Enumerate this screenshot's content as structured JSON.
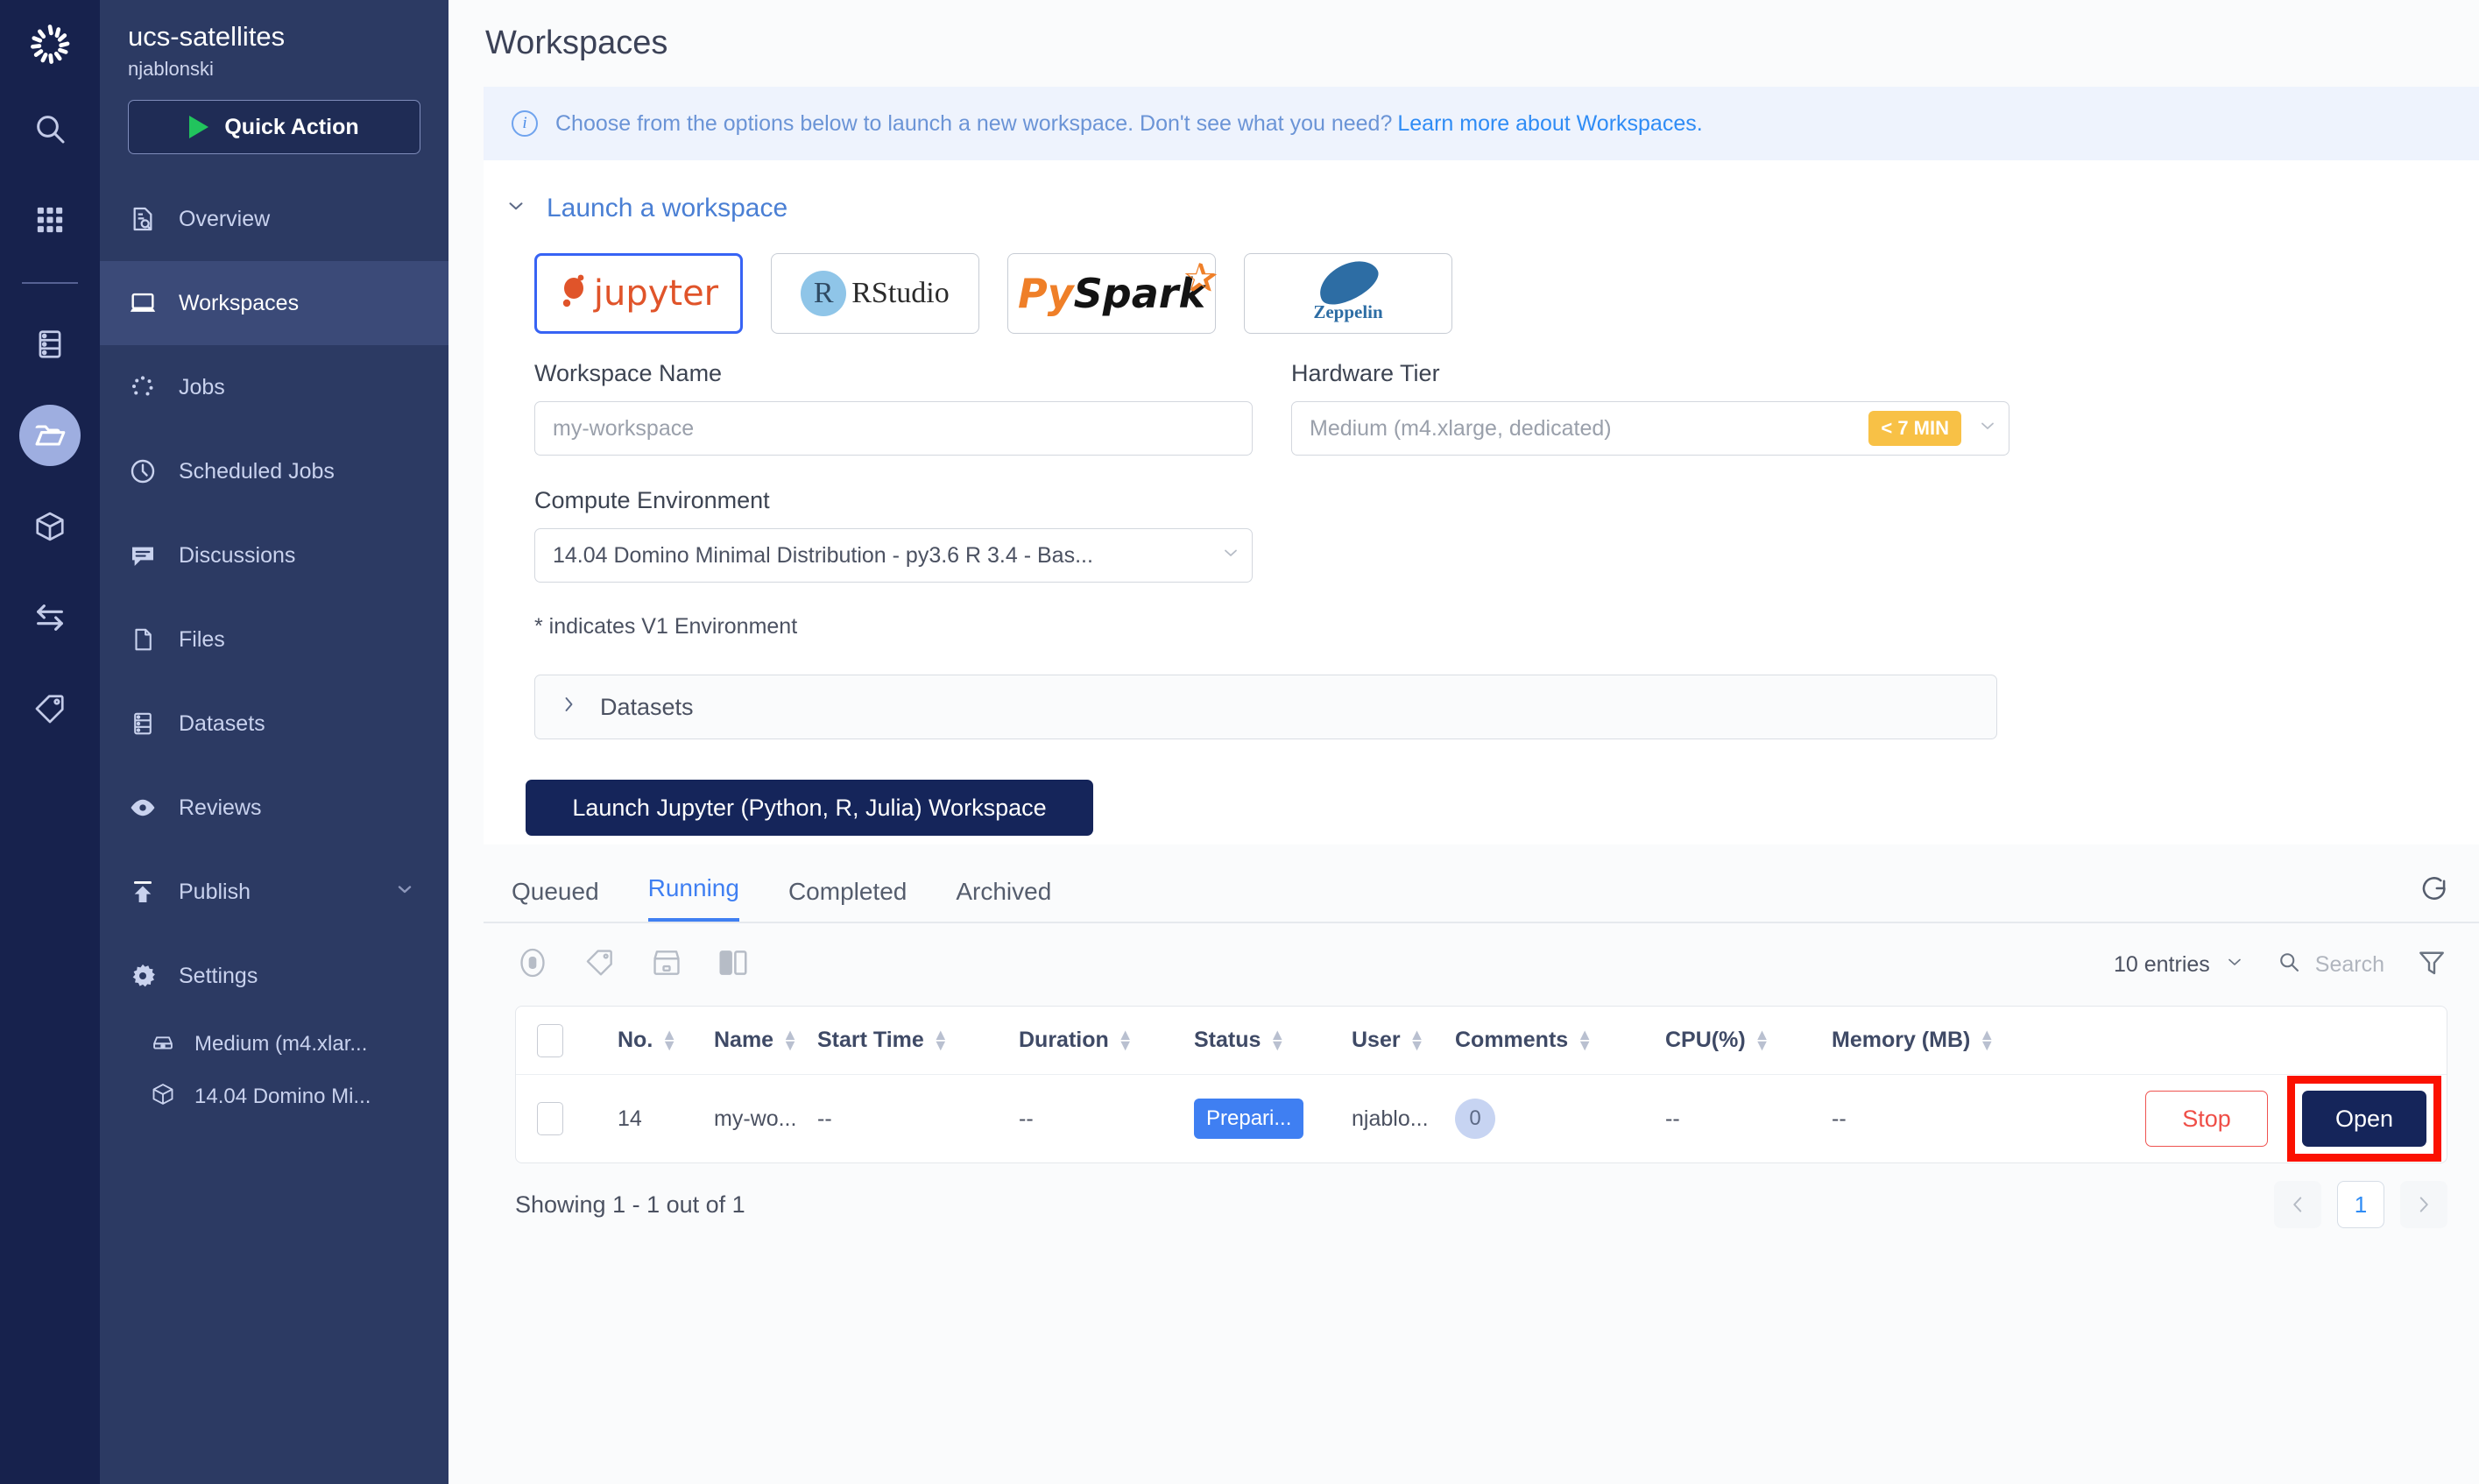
{
  "rail": {
    "logo_icon": "domino-logo-icon",
    "items": [
      {
        "icon": "search-icon",
        "active": false
      },
      {
        "icon": "grid-apps-icon",
        "active": false
      },
      {
        "icon": "server-icon",
        "active": false
      },
      {
        "icon": "folder-open-icon",
        "active": true
      },
      {
        "icon": "cube-icon",
        "active": false
      },
      {
        "icon": "transfer-arrows-icon",
        "active": false
      },
      {
        "icon": "tag-icon",
        "active": false
      }
    ]
  },
  "sidebar": {
    "project_name": "ucs-satellites",
    "owner": "njablonski",
    "quick_action_label": "Quick Action",
    "items": [
      {
        "label": "Overview",
        "icon": "document-search-icon",
        "active": false
      },
      {
        "label": "Workspaces",
        "icon": "laptop-icon",
        "active": true
      },
      {
        "label": "Jobs",
        "icon": "spinner-dots-icon",
        "active": false
      },
      {
        "label": "Scheduled Jobs",
        "icon": "clock-icon",
        "active": false
      },
      {
        "label": "Discussions",
        "icon": "chat-bubble-icon",
        "active": false
      },
      {
        "label": "Files",
        "icon": "file-icon",
        "active": false
      },
      {
        "label": "Datasets",
        "icon": "database-icon",
        "active": false
      },
      {
        "label": "Reviews",
        "icon": "eye-icon",
        "active": false
      },
      {
        "label": "Publish",
        "icon": "upload-icon",
        "active": false,
        "expandable": true
      },
      {
        "label": "Settings",
        "icon": "gear-icon",
        "active": false
      }
    ],
    "sub_items": [
      {
        "label": "Medium (m4.xlar...",
        "icon": "hardware-tier-icon"
      },
      {
        "label": "14.04 Domino Mi...",
        "icon": "cube-icon"
      }
    ]
  },
  "main": {
    "page_title": "Workspaces",
    "info_banner": {
      "icon": "info-icon",
      "text": "Choose from the options below to launch a new workspace. Don't see what you need?",
      "link_text": "Learn more about Workspaces."
    },
    "launch_section": {
      "toggle_icon": "chevron-down-icon",
      "title": "Launch a workspace",
      "ide_cards": [
        {
          "name": "jupyter",
          "label": "jupyter",
          "selected": true
        },
        {
          "name": "rstudio",
          "label": "RStudio",
          "selected": false
        },
        {
          "name": "pyspark",
          "label": "PySpark",
          "selected": false
        },
        {
          "name": "zeppelin",
          "label": "Zeppelin",
          "selected": false
        }
      ],
      "workspace_name": {
        "label": "Workspace Name",
        "value": "",
        "placeholder": "my-workspace"
      },
      "hardware_tier": {
        "label": "Hardware Tier",
        "value": "Medium (m4.xlarge, dedicated)",
        "badge": "< 7 MIN",
        "badge_color": "#f8c146",
        "chevron_icon": "chevron-down-icon"
      },
      "compute_environment": {
        "label": "Compute Environment",
        "value": "14.04 Domino Minimal Distribution - py3.6 R 3.4 - Bas...",
        "chevron_icon": "chevron-down-icon"
      },
      "v1_note": "* indicates V1 Environment",
      "datasets_accordion": {
        "label": "Datasets",
        "toggle_icon": "chevron-right-icon"
      },
      "launch_button": "Launch Jupyter (Python, R, Julia) Workspace"
    },
    "tabs": [
      {
        "label": "Queued",
        "active": false
      },
      {
        "label": "Running",
        "active": true
      },
      {
        "label": "Completed",
        "active": false
      },
      {
        "label": "Archived",
        "active": false
      }
    ],
    "refresh_icon": "refresh-icon",
    "toolbar": {
      "icons": [
        "stop-circle-icon",
        "tag-icon",
        "archive-icon",
        "columns-icon"
      ],
      "entries_label": "10 entries",
      "entries_chevron": "chevron-down-icon",
      "search_icon": "search-icon",
      "search_placeholder": "Search",
      "filter_icon": "filter-icon"
    },
    "table": {
      "columns": [
        "No.",
        "Name",
        "Start Time",
        "Duration",
        "Status",
        "User",
        "Comments",
        "CPU(%)",
        "Memory (MB)"
      ],
      "rows": [
        {
          "no": "14",
          "name": "my-wo...",
          "start_time": "--",
          "duration": "--",
          "status": "Prepari...",
          "status_color": "#3f7ff2",
          "user": "njablo...",
          "comments": "0",
          "cpu": "--",
          "memory": "--",
          "stop_label": "Stop",
          "open_label": "Open"
        }
      ]
    },
    "footer": {
      "showing": "Showing 1 - 1 out of 1",
      "prev_icon": "chevron-left-icon",
      "next_icon": "chevron-right-icon",
      "current_page": "1"
    }
  }
}
